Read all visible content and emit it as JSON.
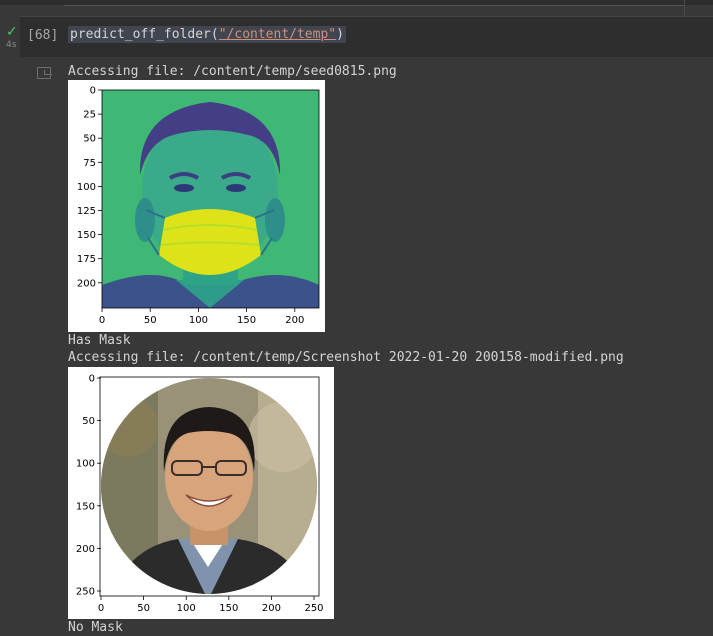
{
  "cell": {
    "status": "✓",
    "duration": "4s",
    "prompt": "[68]",
    "code_prefix": "predict_off_folder(",
    "code_string": "\"/content/temp\"",
    "code_suffix": ")"
  },
  "outputs": [
    {
      "access_line": "Accessing file: /content/temp/seed0815.png",
      "result": "Has Mask",
      "x_ticks": [
        "0",
        "50",
        "100",
        "150",
        "200"
      ],
      "y_ticks": [
        "0",
        "25",
        "50",
        "75",
        "100",
        "125",
        "150",
        "175",
        "200"
      ]
    },
    {
      "access_line": "Accessing file: /content/temp/Screenshot 2022-01-20 200158-modified.png",
      "result": "No Mask",
      "x_ticks": [
        "0",
        "50",
        "100",
        "150",
        "200",
        "250"
      ],
      "y_ticks": [
        "0",
        "50",
        "100",
        "150",
        "200",
        "250"
      ]
    }
  ]
}
